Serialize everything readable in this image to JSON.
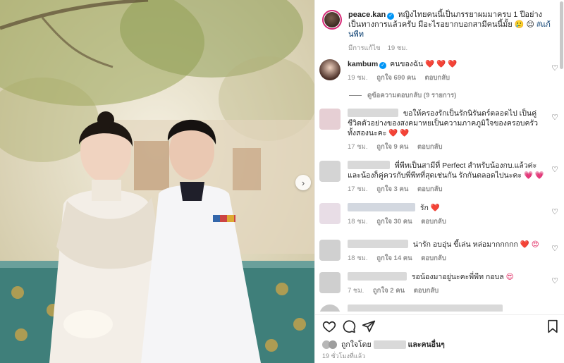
{
  "post": {
    "username": "peace.kan",
    "caption": "หญิงไทยคนนี้เป็นภรรยาผมมาครบ 1 ปีอย่างเป็นทางการแล้วครับ มีอะไรอยากบอกสามีคนนี้มั้ย",
    "caption_emoji": "🥲 😌",
    "hashtag": "#แก้นพีท",
    "edited_label": "มีการแก้ไข",
    "edited_time": "19 ชม."
  },
  "comments": [
    {
      "username": "kambum",
      "verified": true,
      "text": "คนของฉัน",
      "hearts": "❤️ ❤️ ❤️",
      "time": "19 ชม.",
      "likes": "ถูกใจ 690 คน",
      "reply": "ตอบกลับ",
      "view_replies": "ดูข้อความตอบกลับ (9 รายการ)"
    },
    {
      "text": "ขอให้ครองรักเป็นรักนิรันดร์ตลอดไป เป็นคู่ชีวิตตัวอย่างของสงคมาหยเป็นความภาคภูมิใจของครอบครัวทั้งสองนะคะ",
      "hearts": "❤️ ❤️",
      "time": "17 ชม.",
      "likes": "ถูกใจ 9 คน",
      "reply": "ตอบกลับ"
    },
    {
      "text": "พี่พีทเป็นสามีที่ Perfect สำหรับน้องกบ.แล้วค่ะ และน้องก็คู่ควรกับพี่พีทที่สุดเช่นกัน รักกันตลอดไปนะคะ",
      "hearts": "💗 💗",
      "time": "17 ชม.",
      "likes": "ถูกใจ 3 คน",
      "reply": "ตอบกลับ"
    },
    {
      "text": "รัก",
      "hearts": "❤️",
      "time": "18 ชม.",
      "likes": "ถูกใจ 30 คน",
      "reply": "ตอบกลับ"
    },
    {
      "text": "น่ารัก อบอุ่น ขี้เล่น หล่อมากกกกก",
      "hearts": "❤️ 😍",
      "time": "18 ชม.",
      "likes": "ถูกใจ 14 คน",
      "reply": "ตอบกลับ"
    },
    {
      "text": "รอน้องมาอยู่นะคะพี่พีท กอบล",
      "hearts": "😍",
      "time": "7 ชม.",
      "likes": "ถูกใจ 2 คน",
      "reply": "ตอบกลับ"
    }
  ],
  "footer": {
    "liked_by_prefix": "ถูกใจโดย",
    "liked_by_suffix": "และคนอื่นๆ",
    "time_ago": "19 ชั่วโมงที่แล้ว"
  },
  "icons": {
    "like": "heart-outline-icon",
    "comment": "comment-bubble-icon",
    "share": "paper-plane-icon",
    "save": "bookmark-icon",
    "carousel": "chevron-right-icon",
    "comment_like": "small-heart-icon"
  },
  "colors": {
    "link": "#00376b",
    "verified": "#0095f6",
    "secondary_text": "#8e8e8e"
  }
}
